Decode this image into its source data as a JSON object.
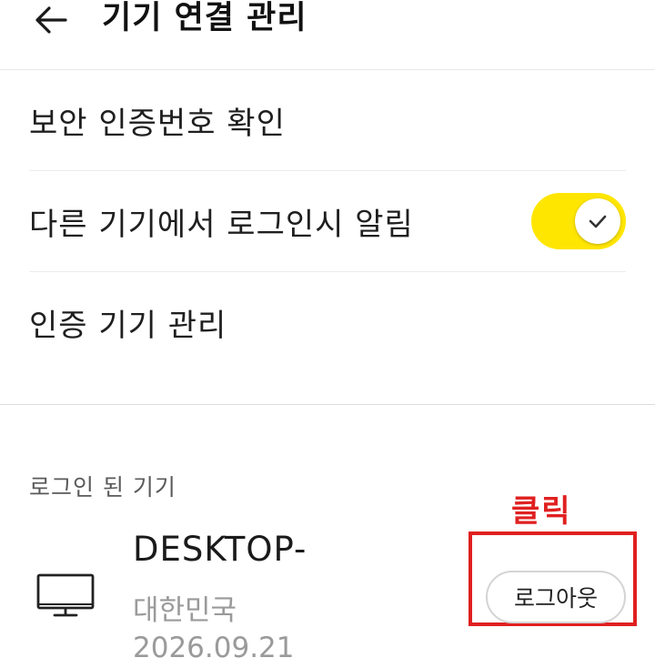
{
  "header": {
    "back_icon": "arrow-left-icon",
    "title": "기기 연결 관리"
  },
  "menu": {
    "items": [
      {
        "label": "보안 인증번호 확인"
      },
      {
        "label": "다른 기기에서 로그인시 알림",
        "toggle": {
          "on": true,
          "color": "#ffe600",
          "knob_icon": "check-icon"
        }
      },
      {
        "label": "인증 기기 관리"
      }
    ]
  },
  "logged_in": {
    "section_label": "로그인 된 기기",
    "annotation": "클릭",
    "annotation_color": "#e02020",
    "device": {
      "icon": "desktop-monitor-icon",
      "name": "DESKTOP-",
      "country": "대한민국",
      "date": "2026.09.21",
      "logout_label": "로그아웃"
    }
  }
}
